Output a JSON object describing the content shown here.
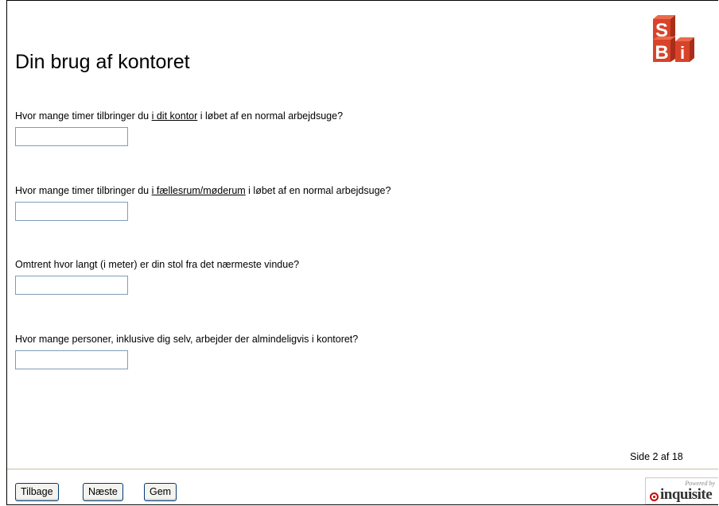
{
  "page": {
    "title": "Din brug af kontoret",
    "page_info": "Side 2 af 18"
  },
  "logo": {
    "letters": [
      "S",
      "B",
      "i"
    ],
    "colors": {
      "front": "#d8432a",
      "top": "#eb6a4c",
      "side": "#a82e1a"
    }
  },
  "questions": [
    {
      "prefix": "Hvor mange timer tilbringer du ",
      "underlined": "i dit kontor",
      "suffix": " i løbet af en normal arbejdsuge?",
      "value": ""
    },
    {
      "prefix": "Hvor mange timer tilbringer du ",
      "underlined": "i fællesrum/møderum",
      "suffix": " i løbet af en normal arbejdsuge?",
      "value": ""
    },
    {
      "prefix": "Omtrent hvor langt (i meter) er din stol fra det nærmeste vindue?",
      "underlined": "",
      "suffix": "",
      "value": ""
    },
    {
      "prefix": "Hvor mange personer, inklusive dig selv, arbejder der almindeligvis i kontoret?",
      "underlined": "",
      "suffix": "",
      "value": ""
    }
  ],
  "buttons": {
    "back": "Tilbage",
    "next": "Næste",
    "save": "Gem"
  },
  "powered": {
    "by": "Powered by",
    "brand": "inquisite"
  }
}
